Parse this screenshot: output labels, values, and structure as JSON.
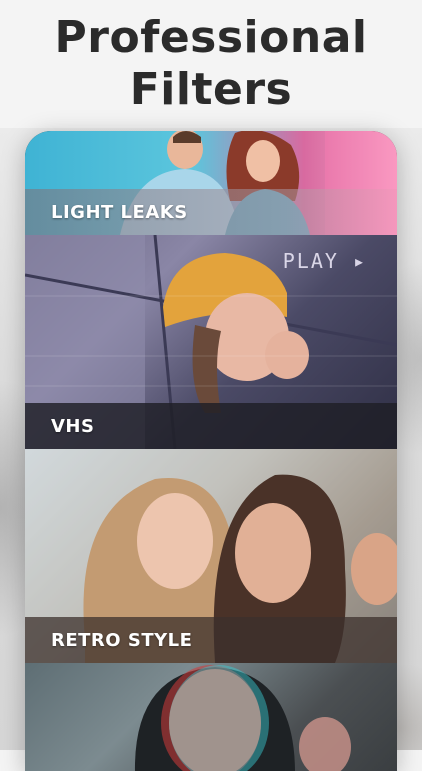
{
  "headline": {
    "line1": "Professional",
    "line2": "Filters"
  },
  "filters": [
    {
      "label": "LIGHT LEAKS"
    },
    {
      "label": "VHS",
      "overlay": "PLAY ▸"
    },
    {
      "label": "RETRO STYLE"
    },
    {
      "label": ""
    }
  ],
  "colors": {
    "headline": "#2b2b2b",
    "label_text": "#ffffff"
  }
}
